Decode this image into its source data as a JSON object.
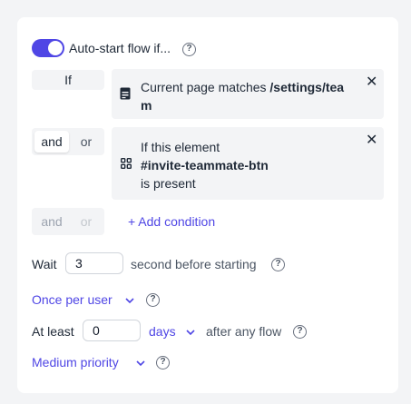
{
  "auto_start": {
    "label": "Auto-start flow if...",
    "enabled": true,
    "help_icon": "help-icon"
  },
  "conditions": {
    "if_label": "If",
    "items": [
      {
        "prefix": "Current page matches ",
        "value": "/settings/tea",
        "value_wrap": "m",
        "icon": "page-icon"
      },
      {
        "line1": "If this element",
        "value": "#invite-teammate-btn",
        "line3": "is present",
        "icon": "element-grid-icon"
      }
    ],
    "and_label": "and",
    "or_label": "or",
    "add_label": "+ Add condition"
  },
  "wait": {
    "label": "Wait",
    "value": "3",
    "suffix": "second before starting"
  },
  "frequency": {
    "label": "Once per user"
  },
  "at_least": {
    "label": "At least",
    "value": "0",
    "unit": "days",
    "suffix": "after any flow"
  },
  "priority": {
    "label": "Medium priority"
  },
  "colors": {
    "accent": "#4f46e5",
    "panel": "#f3f4f6"
  }
}
